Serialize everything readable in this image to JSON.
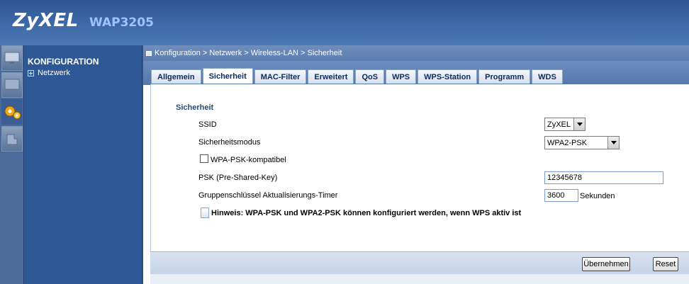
{
  "header": {
    "brand": "ZyXEL",
    "model": "WAP3205"
  },
  "rail": {
    "items": [
      "monitor-icon",
      "screen-icon",
      "gears-icon",
      "maintenance-icon"
    ]
  },
  "sidebar": {
    "title": "KONFIGURATION",
    "items": [
      {
        "label": "Netzwerk",
        "icon": "expand-plus-icon"
      }
    ]
  },
  "breadcrumb": {
    "text": "Konfiguration > Netzwerk > Wireless-LAN > Sicherheit"
  },
  "tabs": [
    {
      "label": "Allgemein"
    },
    {
      "label": "Sicherheit"
    },
    {
      "label": "MAC-Filter"
    },
    {
      "label": "Erweitert"
    },
    {
      "label": "QoS"
    },
    {
      "label": "WPS"
    },
    {
      "label": "WPS-Station"
    },
    {
      "label": "Programm"
    },
    {
      "label": "WDS"
    }
  ],
  "active_tab": "Sicherheit",
  "form": {
    "section_title": "Sicherheit",
    "ssid_label": "SSID",
    "ssid_value": "ZyXEL",
    "mode_label": "Sicherheitsmodus",
    "mode_value": "WPA2-PSK",
    "wpa_compat_label": "WPA-PSK-kompatibel",
    "wpa_compat_checked": false,
    "psk_label": "PSK (Pre-Shared-Key)",
    "psk_value": "12345678",
    "timer_label": "Gruppenschlüssel Aktualisierungs-Timer",
    "timer_value": "3600",
    "timer_unit": "Sekunden",
    "hint": "Hinweis: WPA-PSK und WPA2-PSK können konfiguriert werden, wenn WPS aktiv ist"
  },
  "buttons": {
    "apply": "Übernehmen",
    "reset": "Reset"
  }
}
